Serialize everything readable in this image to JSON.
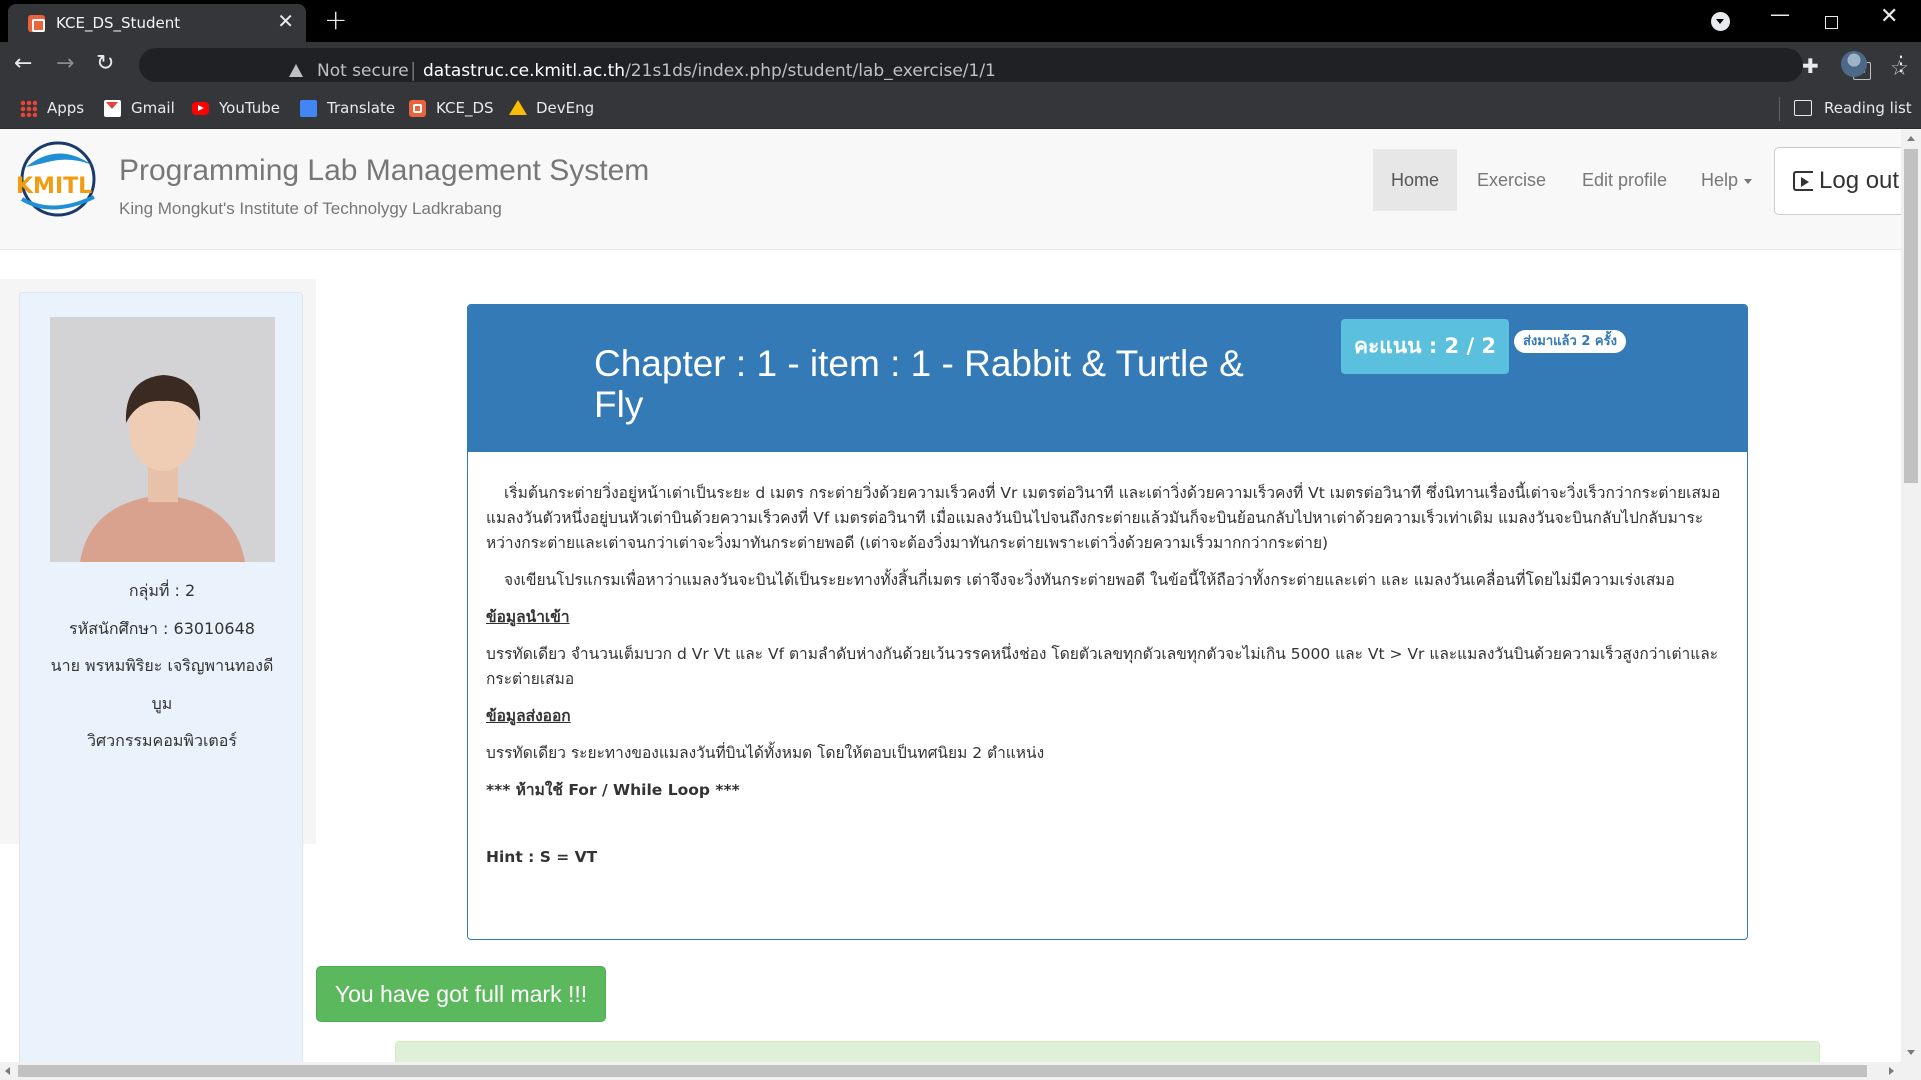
{
  "browser": {
    "tab_title": "KCE_DS_Student",
    "new_tab_symbol": "+",
    "close_symbol": "✕",
    "not_secure": "Not secure",
    "url_host": "datastruc.ce.kmitl.ac.th",
    "url_path": "/21s1ds/index.php/student/lab_exercise/1/1",
    "bookmarks": [
      {
        "label": "Apps",
        "icon": "apps-grid-icon"
      },
      {
        "label": "Gmail",
        "icon": "gmail-icon"
      },
      {
        "label": "YouTube",
        "icon": "youtube-icon"
      },
      {
        "label": "Translate",
        "icon": "translate-icon"
      },
      {
        "label": "KCE_DS",
        "icon": "kce-ds-icon"
      },
      {
        "label": "DevEng",
        "icon": "google-drive-icon"
      }
    ],
    "reading_list": "Reading list"
  },
  "site": {
    "title": "Programming Lab Management System",
    "subtitle": "King Mongkut's Institute of Technolygy Ladkrabang",
    "nav": {
      "home": "Home",
      "exercise": "Exercise",
      "edit_profile": "Edit profile",
      "help": "Help",
      "logout": "Log out"
    }
  },
  "student": {
    "group": "กลุ่มที่ : 2",
    "student_id": "รหัสนักศึกษา : 63010648",
    "name_line1": "นาย พรหมพิริยะ เจริญพานทองดี",
    "name_line2": "บูม",
    "department": "วิศวกรรมคอมพิวเตอร์"
  },
  "exercise": {
    "title": "Chapter : 1 - item : 1 - Rabbit & Turtle & Fly",
    "score": "คะแนน : 2 / 2",
    "submitted": "ส่งมาแล้ว 2 ครั้ง",
    "para1": "เริ่มต้นกระต่ายวิ่งอยู่หน้าเต่าเป็นระยะ d เมตร กระต่ายวิ่งด้วยความเร็วคงที่ Vr เมตรต่อวินาที และเต่าวิ่งด้วยความเร็วคงที่ Vt เมตรต่อวินาที ซึ่งนิทานเรื่องนี้เต่าจะวิ่งเร็วกว่ากระต่ายเสมอ แมลงวันตัวหนึ่งอยู่บนหัวเต่าบินด้วยความเร็วคงที่ Vf เมตรต่อวินาที เมื่อแมลงวันบินไปจนถึงกระต่ายแล้วมันก็จะบินย้อนกลับไปหาเต่าด้วยความเร็วเท่าเดิม แมลงวันจะบินกลับไปกลับมาระหว่างกระต่ายและเต่าจนกว่าเต่าจะวิ่งมาทันกระต่ายพอดี (เต่าจะต้องวิ่งมาทันกระต่ายเพราะเต่าวิ่งด้วยความเร็วมากกว่ากระต่าย)",
    "para2": "จงเขียนโปรแกรมเพื่อหาว่าแมลงวันจะบินได้เป็นระยะทางทั้งสิ้นกี่เมตร เต่าจึงจะวิ่งทันกระต่ายพอดี ในข้อนี้ให้ถือว่าทั้งกระต่ายและเต่า และ แมลงวันเคลื่อนที่โดยไม่มีความเร่งเสมอ",
    "input_heading": "ข้อมูลนำเข้า",
    "input_text": "บรรทัดเดียว จำนวนเต็มบวก d Vr Vt และ Vf ตามลำดับห่างกันด้วยเว้นวรรคหนึ่งช่อง โดยตัวเลขทุกตัวเลขทุกตัวจะไม่เกิน 5000 และ Vt > Vr และแมลงวันบินด้วยความเร็วสูงกว่าเต่าและกระต่ายเสมอ",
    "output_heading": "ข้อมูลส่งออก",
    "output_text": "บรรทัดเดียว ระยะทางของแมลงวันที่บินได้ทั้งหมด โดยให้ตอบเป็นทศนิยม 2 ตำแหน่ง",
    "rule": "*** ห้ามใช้ For / While Loop ***",
    "hint": "Hint : S = VT"
  },
  "result": {
    "full_mark": "You have got full mark !!!"
  },
  "colors": {
    "primary": "#337ab7",
    "info": "#5bc0de",
    "success": "#5cb85c",
    "sidebar_bg": "#eaf3fc"
  }
}
